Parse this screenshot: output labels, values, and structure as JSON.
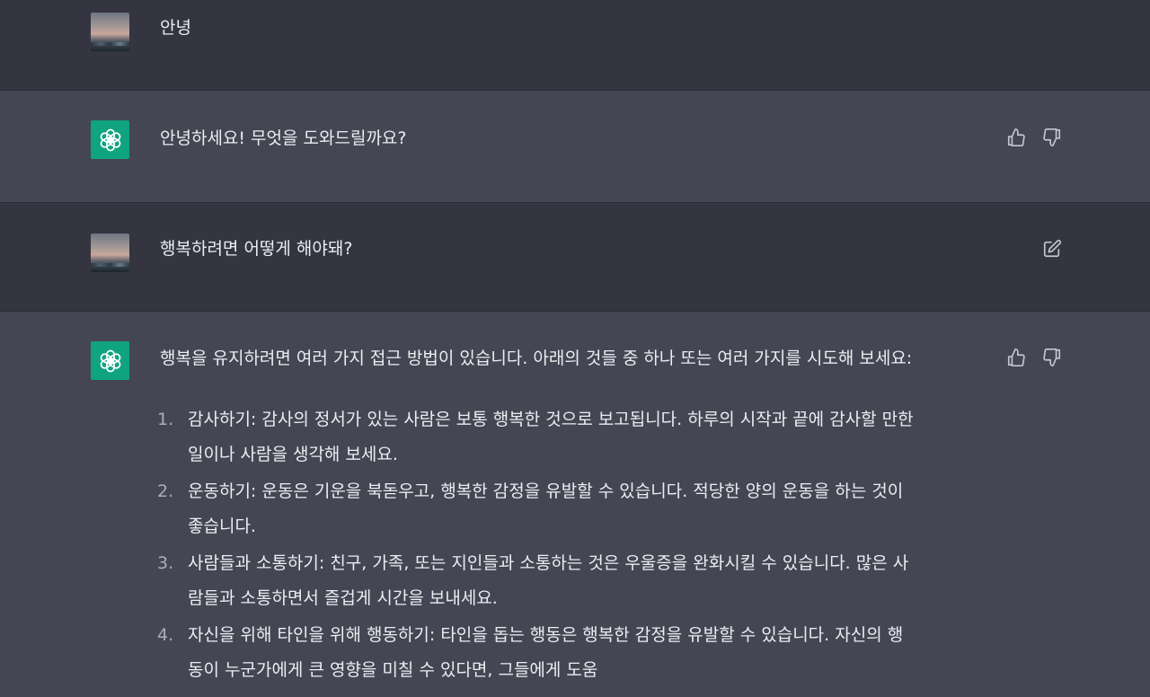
{
  "messages": [
    {
      "role": "user",
      "text": "안녕"
    },
    {
      "role": "assistant",
      "text": "안녕하세요! 무엇을 도와드릴까요?"
    },
    {
      "role": "user",
      "text": "행복하려면 어떻게 해야돼?"
    },
    {
      "role": "assistant",
      "intro": "행복을 유지하려면 여러 가지 접근 방법이 있습니다. 아래의 것들 중 하나 또는 여러 가지를 시도해 보세요:",
      "items": [
        {
          "num": "1.",
          "line1": "감사하기: 감사의 정서가 있는 사람은 보통 행복한 것으로 보고됩니다. 하루의 시작과 끝에 감사할 만한",
          "line2": "일이나 사람을 생각해 보세요."
        },
        {
          "num": "2.",
          "line1": "운동하기: 운동은 기운을 북돋우고, 행복한 감정을 유발할 수 있습니다. 적당한 양의 운동을 하는 것이",
          "line2": "좋습니다."
        },
        {
          "num": "3.",
          "line1": "사람들과 소통하기: 친구, 가족, 또는 지인들과 소통하는 것은 우울증을 완화시킬 수 있습니다. 많은 사",
          "line2": "람들과 소통하면서 즐겁게 시간을 보내세요."
        },
        {
          "num": "4.",
          "line1": "자신을 위해 타인을 위해 행동하기: 타인을 돕는 행동은 행복한 감정을 유발할 수 있습니다. 자신의 행",
          "line2": "동이 누군가에게 큰 영향을 미칠 수 있다면, 그들에게 도움"
        }
      ]
    }
  ],
  "icons": {
    "thumbs_up": "thumbs-up-icon",
    "thumbs_down": "thumbs-down-icon",
    "edit": "edit-icon",
    "openai_logo": "openai-logo-icon"
  },
  "colors": {
    "user_bg": "#343541",
    "assistant_bg": "#444654",
    "bot_avatar": "#10a37f",
    "text": "#ececf1",
    "muted": "#acacbe"
  }
}
